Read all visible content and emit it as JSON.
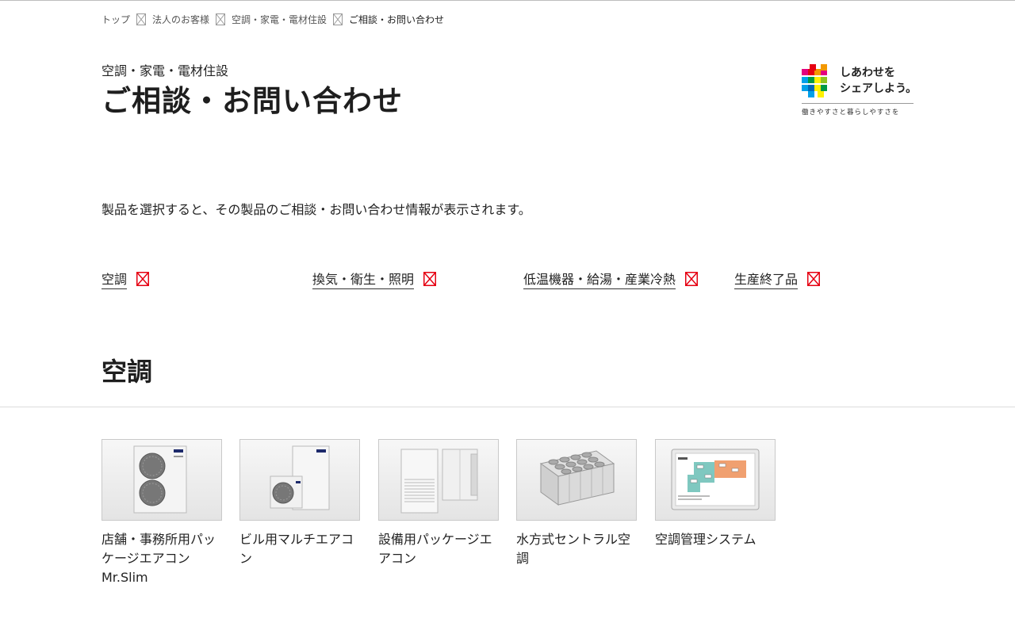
{
  "breadcrumb": {
    "items": [
      "トップ",
      "法人のお客様",
      "空調・家電・電材住設"
    ],
    "current": "ご相談・お問い合わせ"
  },
  "header": {
    "section_label": "空調・家電・電材住設",
    "title": "ご相談・お問い合わせ"
  },
  "logo": {
    "line1": "しあわせを",
    "line2": "シェアしよう。",
    "tagline": "働きやすさと暮らしやすさを"
  },
  "intro": "製品を選択すると、その製品のご相談・お問い合わせ情報が表示されます。",
  "anchor_links": [
    "空調",
    "換気・衛生・照明",
    "低温機器・給湯・産業冷熱",
    "生産終了品"
  ],
  "category": {
    "title": "空調",
    "products": [
      {
        "label": "店舗・事務所用パッケージエアコン Mr.Slim",
        "icon": "outdoor-unit-twin-fan"
      },
      {
        "label": "ビル用マルチエアコン",
        "icon": "building-multi-unit"
      },
      {
        "label": "設備用パッケージエアコン",
        "icon": "equipment-package-unit"
      },
      {
        "label": "水方式セントラル空調",
        "icon": "central-chiller-unit"
      },
      {
        "label": "空調管理システム",
        "icon": "control-system-screen"
      }
    ]
  },
  "colors": {
    "accent_red": "#e60012",
    "text": "#222222",
    "divider": "#dcdcdc"
  }
}
